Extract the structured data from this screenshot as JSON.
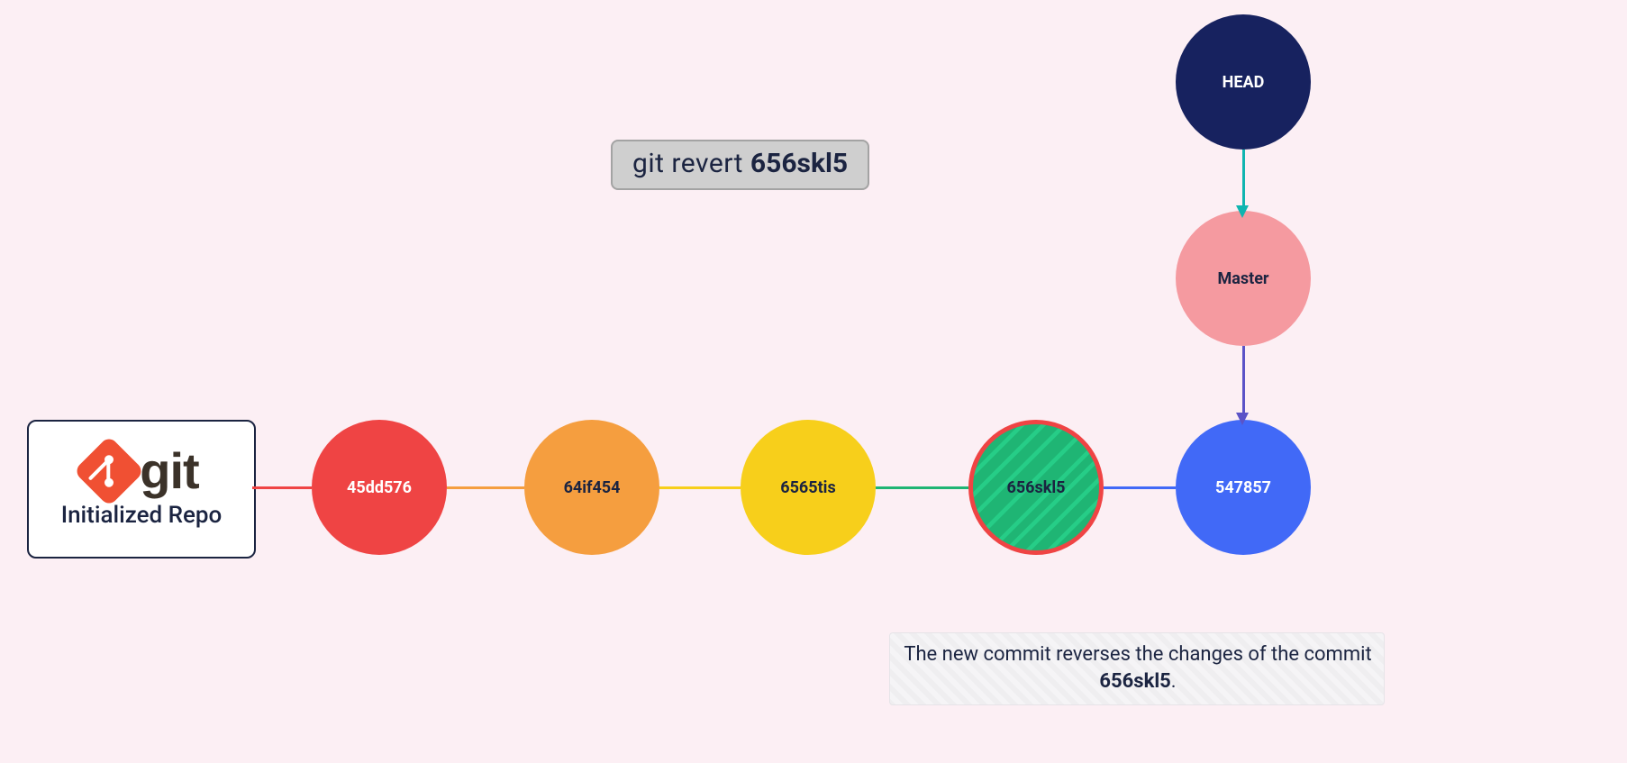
{
  "command": {
    "prefix": "git revert ",
    "hash": "656skl5"
  },
  "repo_card": {
    "word": "git",
    "caption": "Initialized Repo"
  },
  "commits": {
    "c1": "45dd576",
    "c2": "64if454",
    "c3": "6565tis",
    "c4": "656skl5",
    "c5": "547857"
  },
  "refs": {
    "head": "HEAD",
    "master": "Master"
  },
  "explain": {
    "pre": "The new commit reverses the changes of the commit ",
    "hash": "656skl5",
    "post": "."
  },
  "colors": {
    "bg": "#fceff4",
    "red": "#ef4444",
    "orange": "#f59e3f",
    "yellow": "#f7cf1b",
    "green": "#1fb574",
    "blue": "#4169f7",
    "pink": "#f59aa0",
    "navy": "#17225f",
    "teal": "#0fb5b0",
    "purple": "#5b53c7"
  }
}
